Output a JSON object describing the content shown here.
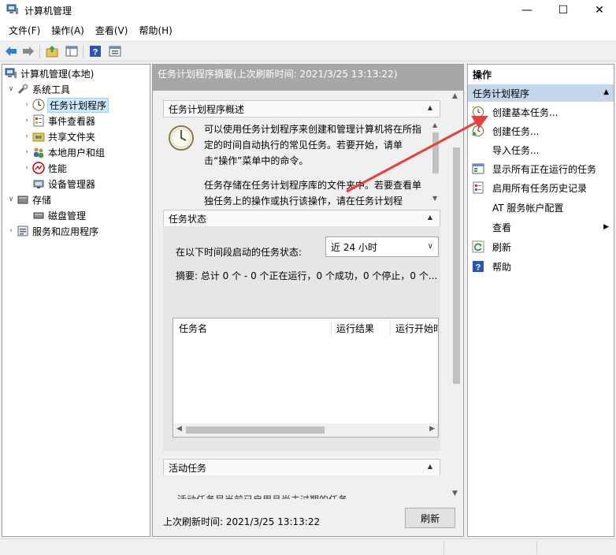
{
  "window": {
    "title": "计算机管理",
    "min_glyph": "—",
    "max_glyph": "☐",
    "close_glyph": "✕"
  },
  "menu": [
    "文件(F)",
    "操作(A)",
    "查看(V)",
    "帮助(H)"
  ],
  "toolbar_icons": [
    "back-icon",
    "forward-icon",
    "up-folder-icon",
    "show-hide-console-tree-icon",
    "help-icon",
    "properties-icon"
  ],
  "tree": {
    "root": "计算机管理(本地)",
    "system_tools": "系统工具",
    "task_scheduler": "任务计划程序",
    "event_viewer": "事件查看器",
    "shared_folders": "共享文件夹",
    "local_users": "本地用户和组",
    "performance": "性能",
    "device_manager": "设备管理器",
    "storage": "存储",
    "disk_management": "磁盘管理",
    "services_apps": "服务和应用程序"
  },
  "middle": {
    "header": "任务计划程序摘要(上次刷新时间: 2021/3/25 13:13:22)",
    "overview_title": "任务计划程序概述",
    "overview_p1": "可以使用任务计划程序来创建和管理计算机将在所指定的时间自动执行的常见任务。若要开始，请单击“操作”菜单中的命令。",
    "overview_p2": "任务存储在任务计划程序库的文件夹中。若要查看单独任务上的操作或执行该操作，请在任务计划程",
    "status_title": "任务状态",
    "status_label": "在以下时间段启动的任务状态:",
    "status_select": "近 24 小时",
    "summary": "摘要: 总计 0 个 - 0 个正在运行，0 个成功，0 个停止，0 个...",
    "columns": [
      "任务名",
      "运行结果",
      "运行开始时"
    ],
    "active_title": "活动任务",
    "active_text": "活动任务是当前已启用且尚未过期的任务。",
    "footer": "上次刷新时间: 2021/3/25 13:13:22",
    "refresh": "刷新"
  },
  "actions": {
    "title": "操作",
    "group": "任务计划程序",
    "items": [
      {
        "label": "创建基本任务...",
        "icon": "create-basic-task-icon"
      },
      {
        "label": "创建任务...",
        "icon": "create-task-icon"
      },
      {
        "label": "导入任务...",
        "icon": ""
      },
      {
        "label": "显示所有正在运行的任务",
        "icon": "running-tasks-icon"
      },
      {
        "label": "启用所有任务历史记录",
        "icon": "history-icon"
      },
      {
        "label": "AT 服务帐户配置",
        "icon": ""
      },
      {
        "label": "查看",
        "icon": ""
      },
      {
        "label": "刷新",
        "icon": "refresh-icon"
      },
      {
        "label": "帮助",
        "icon": "help-icon"
      }
    ]
  },
  "colors": {
    "selection": "#cce8ff",
    "action_group_bg": "#c4d6ea",
    "annotation_arrow": "#e8413b",
    "mid_header_bg": "#a7a7a7"
  }
}
